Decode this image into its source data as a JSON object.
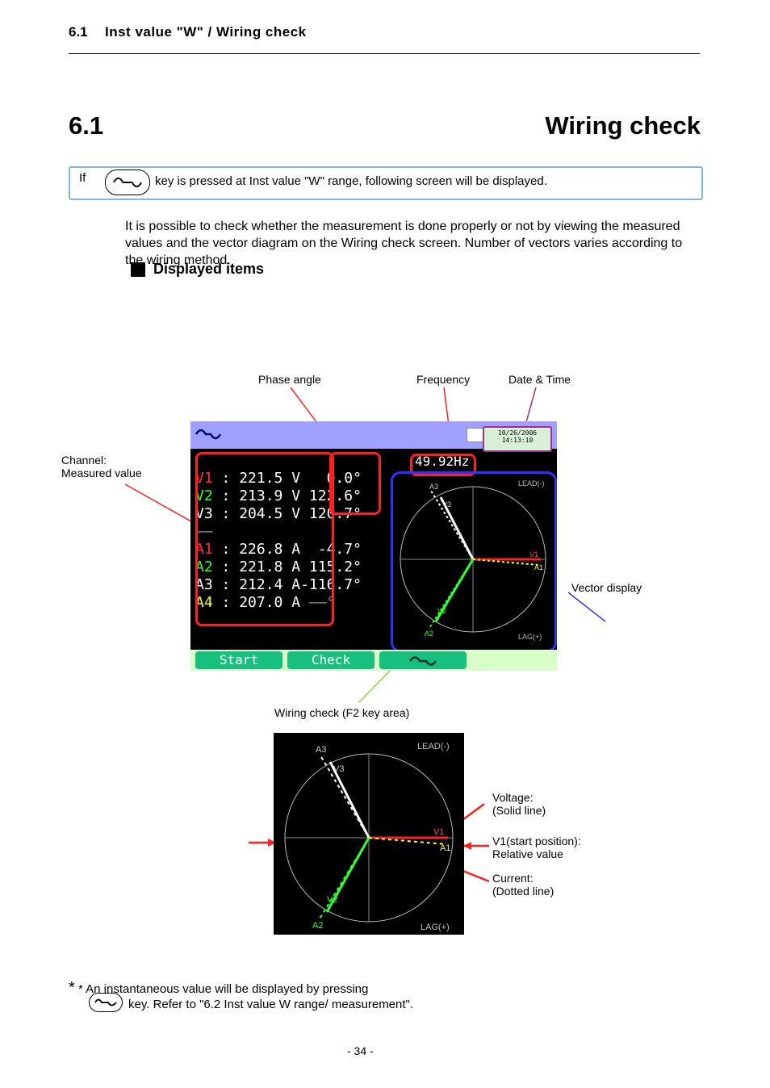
{
  "header": {
    "page_label": "6.1",
    "title": "Inst value \"W\" / Wiring check",
    "section_num": "6.1",
    "section_title": "Wiring check"
  },
  "keybox": {
    "prefix": "If",
    "rest": "key is pressed at Inst value \"W\" range, following screen will be displayed."
  },
  "subheading_1": "Displayed items",
  "para1": "It is possible to check whether the measurement is done properly or not by viewing the measured values and the vector diagram on the Wiring check screen. Number of vectors varies according to the wiring method.",
  "lcd": {
    "datetime": {
      "date": "10/26/2006",
      "time": "14:13:10"
    },
    "freq": "49.92Hz",
    "rows": {
      "v": [
        {
          "name": "V1",
          "val": "221.5 V",
          "ang": "0.0°",
          "color": "#ff3030"
        },
        {
          "name": "V2",
          "val": "213.9 V",
          "ang": "122.6°",
          "color": "#30ff30"
        },
        {
          "name": "V3",
          "val": "204.5 V",
          "ang": "120.7°",
          "color": "#ffffff"
        }
      ],
      "a": [
        {
          "name": "A1",
          "val": "226.8 A",
          "ang": "-4.7°",
          "color": "#ff3030"
        },
        {
          "name": "A2",
          "val": "221.8 A",
          "ang": "115.2°",
          "color": "#30ff30"
        },
        {
          "name": "A3",
          "val": "212.4 A",
          "ang": "-116.7°",
          "color": "#ffffff"
        },
        {
          "name": "A4",
          "val": "207.0 A",
          "ang": "——°",
          "color": "#ffff30"
        }
      ]
    },
    "vector_tags": {
      "lead": "LEAD(-)",
      "lag": "LAG(+)",
      "a3": "A3",
      "v3": "V3",
      "v1": "V1",
      "a1": "A1",
      "v2": "V2",
      "a2": "A2"
    },
    "fnkeys": {
      "f1": "Start",
      "f2": "Check",
      "f3_icon": "wave-icon"
    }
  },
  "callouts": {
    "phase_angle": "Phase angle",
    "freq": "Frequency",
    "datetime": "Date & Time",
    "channel": "Channel: Measured value",
    "vector": "Vector display",
    "wiring_check": "Wiring check (F2 key area)"
  },
  "vec2_labels": {
    "voltage": "Voltage:\n(Solid line)",
    "start": "V1(start position):\nRelative value",
    "current": "Current:\n(Dotted line)",
    "lead": "LEAD(-)",
    "lag": "LAG(+)",
    "a3": "A3",
    "v3": "V3",
    "v1": "V1",
    "a1": "A1",
    "v2": "V2",
    "a2": "A2"
  },
  "bottom": {
    "line1": "* An instantaneous value will be displayed by pressing",
    "line2": "key. Refer to \"6.2 Inst value W range/ measurement\"."
  },
  "footer": "- 34 -"
}
